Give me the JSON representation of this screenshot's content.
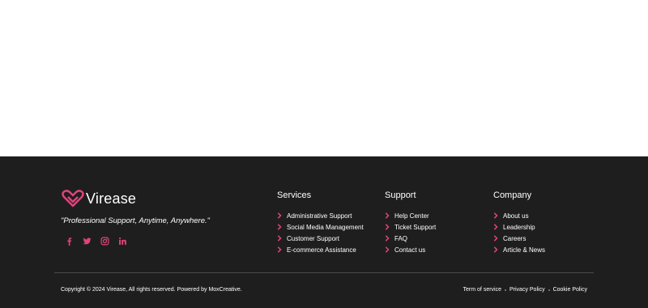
{
  "brand": {
    "name": "Virease",
    "tagline": "\"Professional Support, Anytime, Anywhere.\""
  },
  "colors": {
    "accent": "#e0447a",
    "footer_bg": "#1f1e1f",
    "text": "#ffffff"
  },
  "socials": [
    {
      "icon": "facebook-icon"
    },
    {
      "icon": "twitter-icon"
    },
    {
      "icon": "instagram-icon"
    },
    {
      "icon": "linkedin-icon"
    }
  ],
  "columns": {
    "services": {
      "title": "Services",
      "links": [
        "Administrative Support",
        "Social Media Management",
        "Customer Support",
        "E-commerce Assistance"
      ]
    },
    "support": {
      "title": "Support",
      "links": [
        "Help Center",
        "Ticket Support",
        "FAQ",
        "Contact us"
      ]
    },
    "company": {
      "title": "Company",
      "links": [
        "About us",
        "Leadership",
        "Careers",
        "Article & News"
      ]
    }
  },
  "bottom": {
    "copyright": "Copyright © 2024 Virease, All rights reserved. Powered by MoxCreative.",
    "legal": [
      "Term of service",
      "Privacy Policy",
      "Cookie Policy"
    ]
  }
}
